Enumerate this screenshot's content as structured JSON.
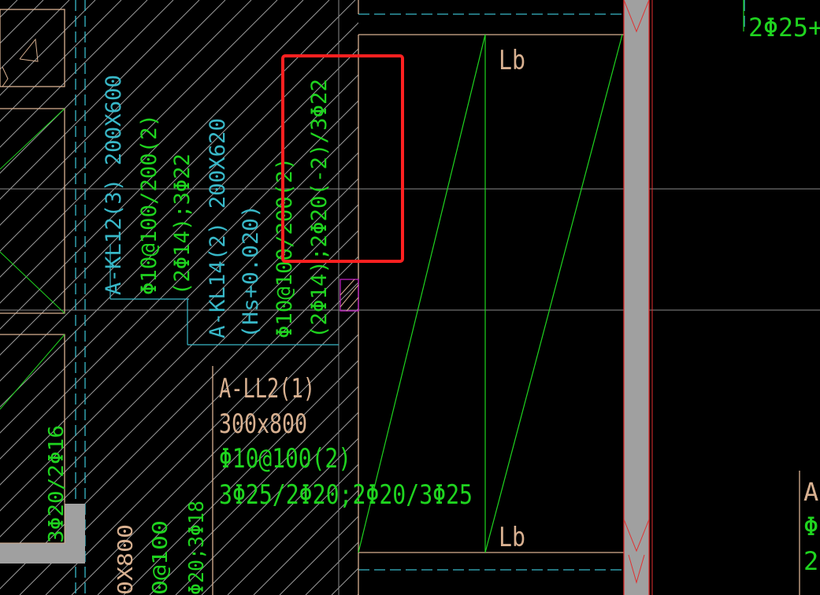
{
  "colors": {
    "background": "#000000",
    "hatch": "#9a9a9a",
    "grid": "#8a8a8a",
    "outline": "#d8b090",
    "cyan": "#38b8c8",
    "green": "#1fd41f",
    "wall": "#a0a0a0",
    "wall_edge": "#e03030",
    "highlight": "#ff2020",
    "magenta": "#c020c0"
  },
  "labels": {
    "kl12_name": "A-KL12(3) 200X600",
    "kl12_stirrup": "Φ10@100/200(2)",
    "kl12_rebar": "(2Φ14);3Φ22",
    "kl14_name": "A-KL14(2) 200X620",
    "kl14_hs": "(Hs+0.020)",
    "kl14_stirrup": "Φ10@100/200(2)",
    "kl14_rebar": "(2Φ14);2Φ20(-2)/3Φ22",
    "ll2_name": "A-LL2(1)",
    "ll2_size": "300x800",
    "ll2_stirrup": "Φ10@100(2)",
    "ll2_rebar": "3Φ25/2Φ20;2Φ20/3Φ25",
    "lb_top": "Lb",
    "lb_bottom": "Lb",
    "top_right_rebar": "2Φ25+",
    "left_vertical_rebar": "3Φ20/2Φ16",
    "bottom_left_1": "0X800",
    "bottom_left_2": "0@100",
    "bottom_left_3": "Φ20;3Φ18",
    "right_edge_1": "A-",
    "right_edge_2": "Φ",
    "right_edge_3": "2"
  }
}
